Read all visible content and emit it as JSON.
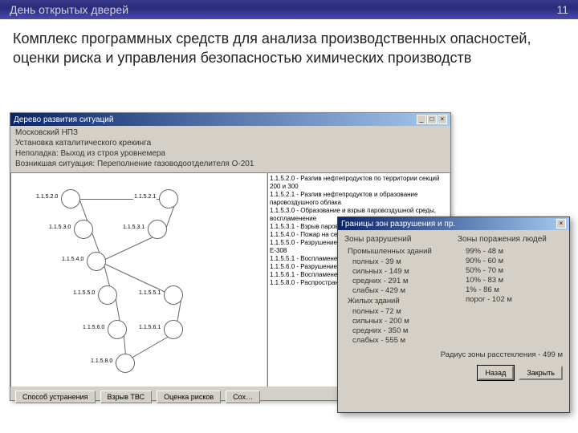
{
  "header": {
    "left": "День открытых дверей",
    "right": "11"
  },
  "mainTitle": "Комплекс программных средств для анализа производственных опасностей, оценки риска и управления безопасностью химических производств",
  "window1": {
    "title": "Дерево развития ситуаций",
    "info": {
      "plant": "Московский НПЗ",
      "unit": "Установка каталитического крекинга",
      "fault": "Неполадка: Выход из строя уровнемера",
      "situation": "Возникшая ситуация: Переполнение газоводоотделителя О-201"
    },
    "events": [
      "1.1.5.2.0 - Разлив нефтепродуктов по территории секций 200 и 300",
      "1.1.5.2.1 - Разлив нефтепродуктов и образование паровоздушного облака",
      "1.1.5.3.0 - Образование и взрыв паровоздушной среды, воспламенение",
      "1.1.5.3.1 - Взрыв паровоздушного облака",
      "1.1.5.4.0 - Пожар на секциях 200 и 300",
      "1.1.5.5.0 - Разрушение и взрыв колонн К-301, Е-307 и Е-308",
      "1.1.5.5.1 - Воспламенение …",
      "1.1.5.6.0 - Разрушение ко…",
      "1.1.5.6.1 - Воспламенение Р-201, Р-101 и регенератора",
      "1.1.5.8.0 - Распространение установки"
    ],
    "nodes": {
      "n1": "1.1.5.2.0",
      "n2": "1.1.5.2.1",
      "n3": "1.1.5.3.0",
      "n4": "1.1.5.3.1",
      "n5": "1.1.5.4.0",
      "n6": "1.1.5.5.0",
      "n7": "1.1.5.5.1",
      "n8": "1.1.5.6.0",
      "n9": "1.1.5.6.1",
      "n10": "1.1.5.8.0"
    },
    "buttons": {
      "b1": "Способ устранения",
      "b2": "Взрыв ТВС",
      "b3": "Оценка рисков",
      "b4": "Сох…"
    }
  },
  "window2": {
    "title": "Границы зон разрушения и пр.",
    "left": {
      "h": "Зоны разрушений",
      "g1": "Промышленных зданий",
      "g1r": [
        "полных  - 39 м",
        "сильных - 149 м",
        "средних - 291 м",
        "слабых  - 429 м"
      ],
      "g2": "Жилых зданий",
      "g2r": [
        "полных  - 72 м",
        "сильных - 200 м",
        "средних - 350 м",
        "слабых  - 555 м"
      ]
    },
    "right": {
      "h": "Зоны поражения людей",
      "rows": [
        "99% - 48 м",
        "90% - 60 м",
        "50% - 70 м",
        "10% - 83 м",
        "1% - 86 м",
        "порог - 102 м"
      ]
    },
    "radius": "Радиус зоны расстекления - 499 м",
    "buttons": {
      "back": "Назад",
      "close": "Закрыть"
    }
  }
}
